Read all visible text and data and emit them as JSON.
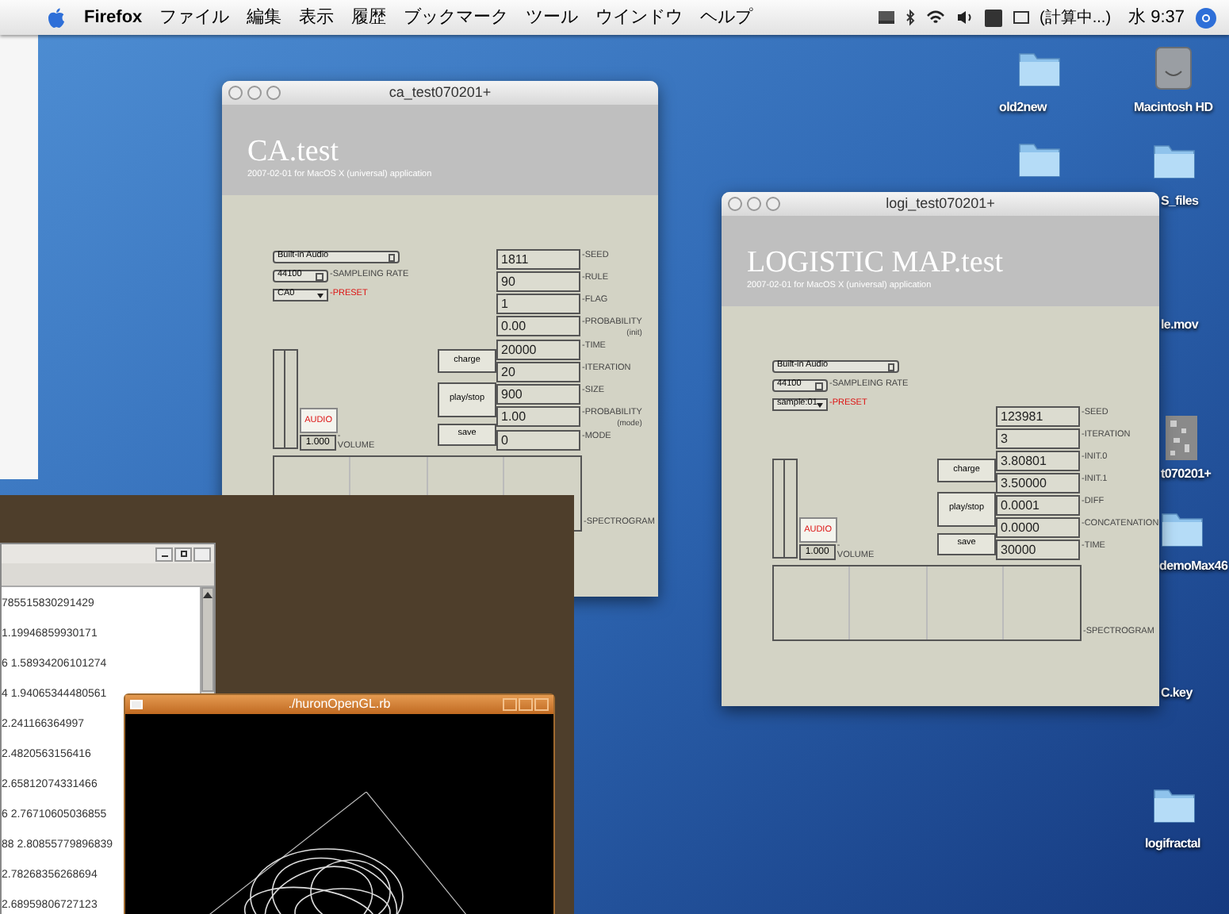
{
  "menu_bar": {
    "app": "Firefox",
    "menus": [
      "ファイル",
      "編集",
      "表示",
      "履歴",
      "ブックマーク",
      "ツール",
      "ウインドウ",
      "ヘルプ"
    ],
    "status_text": "(計算中...)",
    "clock": "水 9:37"
  },
  "desktop_icons": [
    {
      "label": "old2new",
      "kind": "folder"
    },
    {
      "label": "Macintosh HD",
      "kind": "drive"
    },
    {
      "kind": "folder"
    },
    {
      "label": "S_files",
      "kind": "folder"
    },
    {
      "label": "le.mov",
      "kind": "none"
    },
    {
      "label": "t070201+",
      "kind": "image"
    },
    {
      "label": "demoMax46",
      "kind": "folder"
    },
    {
      "label": "C.key",
      "kind": "none"
    },
    {
      "label": "logifractal",
      "kind": "folder"
    }
  ],
  "windows": [
    {
      "title": "ca_test070201+",
      "heading": "CA.test",
      "subtitle": "2007-02-01 for MacOS X (universal) application",
      "device": "Built-in Audio",
      "sampling_rate": "44100",
      "sampling_label": "-SAMPLEING RATE",
      "preset": "CA0",
      "preset_label": "-PRESET",
      "audio_label": "AUDIO",
      "volume": "1.000",
      "volume_label": "-VOLUME",
      "buttons": [
        "charge",
        "play/stop",
        "save"
      ],
      "spectrogram_label": "-SPECTROGRAM",
      "params": [
        {
          "value": "1811",
          "label": "-SEED"
        },
        {
          "value": "90",
          "label": "-RULE"
        },
        {
          "value": "1",
          "label": "-FLAG"
        },
        {
          "value": "0.00",
          "label": "-PROBABILITY",
          "sublabel": "(init)"
        },
        {
          "value": "20000",
          "label": "-TIME"
        },
        {
          "value": "20",
          "label": "-ITERATION"
        },
        {
          "value": "900",
          "label": "-SIZE"
        },
        {
          "value": "1.00",
          "label": "-PROBABILITY",
          "sublabel": "(mode)"
        },
        {
          "value": "0",
          "label": "-MODE"
        }
      ]
    },
    {
      "title": "logi_test070201+",
      "heading": "LOGISTIC MAP.test",
      "subtitle": "2007-02-01 for MacOS X (universal) application",
      "device": "Built-in Audio",
      "sampling_rate": "44100",
      "sampling_label": "-SAMPLEING RATE",
      "preset": "sample:01",
      "preset_label": "-PRESET",
      "audio_label": "AUDIO",
      "volume": "1.000",
      "volume_label": "-VOLUME",
      "buttons": [
        "charge",
        "play/stop",
        "save"
      ],
      "spectrogram_label": "-SPECTROGRAM",
      "params": [
        {
          "value": "123981",
          "label": "-SEED"
        },
        {
          "value": "3",
          "label": "-ITERATION"
        },
        {
          "value": "3.80801",
          "label": "-INIT.0"
        },
        {
          "value": "3.50000",
          "label": "-INIT.1"
        },
        {
          "value": "0.0001",
          "label": "-DIFF"
        },
        {
          "value": "0.0000",
          "label": "-CONCATENATION"
        },
        {
          "value": "30000",
          "label": "-TIME"
        }
      ]
    }
  ],
  "terminal": {
    "lines": [
      "785515830291429",
      "1.19946859930171",
      "6 1.58934206101274",
      "4 1.94065344480561",
      "2.241166364997",
      "2.4820563156416",
      "2.65812074331466",
      "6 2.76710605036855",
      "88 2.80855779896839",
      "2.78268356268694",
      "2.68959806727123"
    ]
  },
  "opengl_window": {
    "title": "./huronOpenGL.rb"
  }
}
